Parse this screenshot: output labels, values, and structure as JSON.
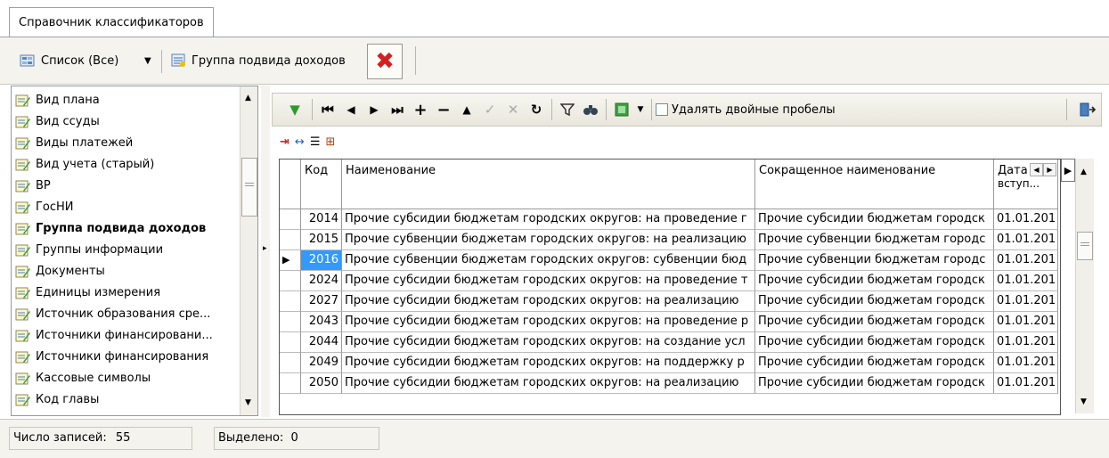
{
  "tab": {
    "label": "Справочник классификаторов"
  },
  "toolbar": {
    "list_label": "Список (Все)",
    "group_label": "Группа подвида доходов"
  },
  "sidebar": {
    "items": [
      {
        "label": "Вид плана",
        "bold": false
      },
      {
        "label": "Вид ссуды",
        "bold": false
      },
      {
        "label": "Виды платежей",
        "bold": false
      },
      {
        "label": "Вид учета (старый)",
        "bold": false
      },
      {
        "label": "ВР",
        "bold": false
      },
      {
        "label": "ГосНИ",
        "bold": false
      },
      {
        "label": "Группа подвида доходов",
        "bold": true
      },
      {
        "label": "Группы информации",
        "bold": false
      },
      {
        "label": "Документы",
        "bold": false
      },
      {
        "label": "Единицы измерения",
        "bold": false
      },
      {
        "label": "Источник образования сре...",
        "bold": false
      },
      {
        "label": "Источники финансировани...",
        "bold": false
      },
      {
        "label": "Источники финансирования",
        "bold": false
      },
      {
        "label": "Кассовые символы",
        "bold": false
      },
      {
        "label": "Код главы",
        "bold": false
      }
    ]
  },
  "grid_toolbar": {
    "checkbox_label": "Удалять двойные пробелы",
    "checkbox_checked": false
  },
  "grid": {
    "columns": {
      "code": "Код",
      "name": "Наименование",
      "short": "Сокращенное наименование",
      "date": "Дата",
      "date_line2": "вступ..."
    },
    "selected_row": 2,
    "rows": [
      {
        "code": "2014",
        "name": "Прочие субсидии бюджетам городских округов: на проведение г",
        "short": "Прочие субсидии бюджетам городск",
        "date": "01.01.201"
      },
      {
        "code": "2015",
        "name": "Прочие субвенции бюджетам городских округов: на реализацию",
        "short": "Прочие субвенции бюджетам городс",
        "date": "01.01.201"
      },
      {
        "code": "2016",
        "name": "Прочие субвенции бюджетам городских округов: субвенции бюд",
        "short": "Прочие субвенции бюджетам городс",
        "date": "01.01.201"
      },
      {
        "code": "2024",
        "name": "Прочие субсидии бюджетам городских округов: на проведение т",
        "short": "Прочие субсидии бюджетам городск",
        "date": "01.01.201"
      },
      {
        "code": "2027",
        "name": "Прочие субсидии бюджетам городских округов: на реализацию",
        "short": "Прочие субсидии бюджетам городск",
        "date": "01.01.201"
      },
      {
        "code": "2043",
        "name": "Прочие субсидии бюджетам городских округов: на проведение р",
        "short": "Прочие субсидии бюджетам городск",
        "date": "01.01.201"
      },
      {
        "code": "2044",
        "name": "Прочие субсидии бюджетам городских округов: на создание усл",
        "short": "Прочие субсидии бюджетам городск",
        "date": "01.01.201"
      },
      {
        "code": "2049",
        "name": "Прочие субсидии бюджетам городских округов: на поддержку р",
        "short": "Прочие субсидии бюджетам городск",
        "date": "01.01.201"
      },
      {
        "code": "2050",
        "name": "Прочие субсидии бюджетам городских округов: на реализацию",
        "short": "Прочие субсидии бюджетам городск",
        "date": "01.01.201"
      }
    ]
  },
  "status": {
    "records_label": "Число записей:",
    "records_value": "55",
    "selected_label": "Выделено:",
    "selected_value": "0"
  },
  "colors": {
    "selection": "#3399ff",
    "close_red": "#d42020",
    "icon_green": "#2e9a2e"
  },
  "icons": [
    "list-icon",
    "dropdown-arrow-icon",
    "group-icon",
    "close-icon",
    "classifier-icon",
    "filter-icon",
    "first-icon",
    "prev-icon",
    "next-icon",
    "last-icon",
    "add-icon",
    "remove-icon",
    "up-icon",
    "confirm-icon",
    "cancel-icon",
    "refresh-icon",
    "funnel-icon",
    "find-icon",
    "export-icon",
    "exit-icon",
    "row-pointer-icon"
  ]
}
